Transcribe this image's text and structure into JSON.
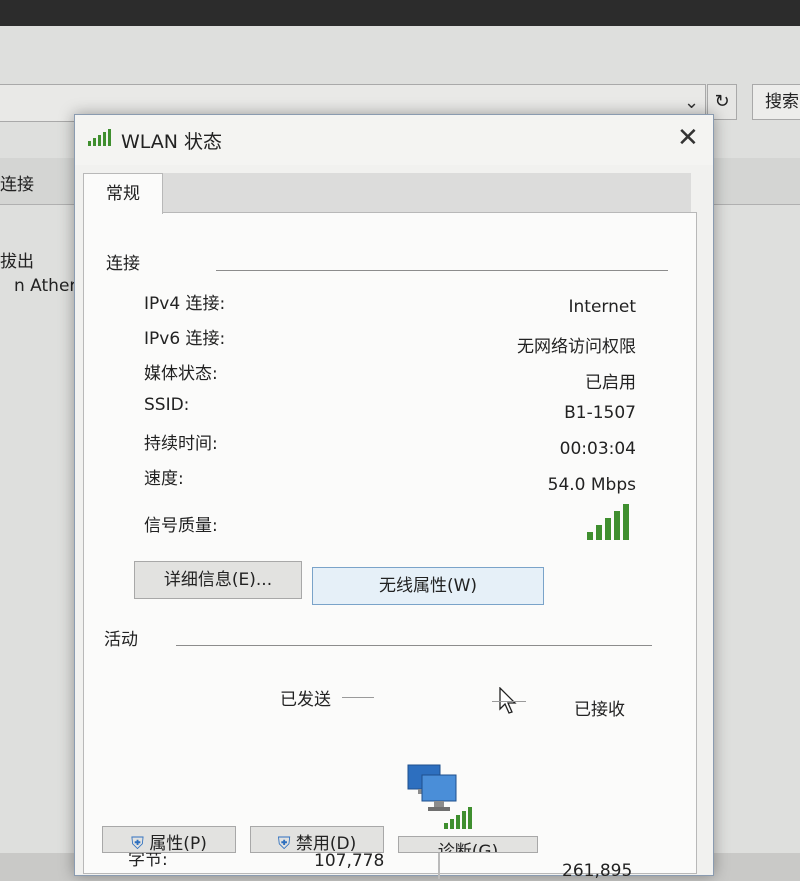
{
  "background": {
    "search_label": "搜索",
    "tab_label": "连接",
    "line1": "拔出",
    "line2": "n Athero"
  },
  "dialog": {
    "title": "WLAN 状态",
    "tab": "常规",
    "connection": {
      "section_label": "连接",
      "rows": [
        {
          "label": "IPv4 连接:",
          "value": "Internet"
        },
        {
          "label": "IPv6 连接:",
          "value": "无网络访问权限"
        },
        {
          "label": "媒体状态:",
          "value": "已启用"
        },
        {
          "label": "SSID:",
          "value": "B1-1507"
        },
        {
          "label": "持续时间:",
          "value": "00:03:04"
        },
        {
          "label": "速度:",
          "value": "54.0 Mbps"
        }
      ],
      "signal_label": "信号质量:",
      "signal_bars": 5
    },
    "buttons": {
      "details": "详细信息(E)...",
      "wireless": "无线属性(W)"
    },
    "activity": {
      "section_label": "活动",
      "sent_label": "已发送",
      "received_label": "已接收",
      "bytes_label": "字节:",
      "sent_bytes": "107,778",
      "received_bytes": "261,895"
    },
    "bottom_buttons": {
      "properties": "属性(P)",
      "disable": "禁用(D)",
      "diagnose": "诊断(G)"
    }
  },
  "colors": {
    "signal": "#3f8f2f",
    "accent": "#7aa3c9"
  }
}
